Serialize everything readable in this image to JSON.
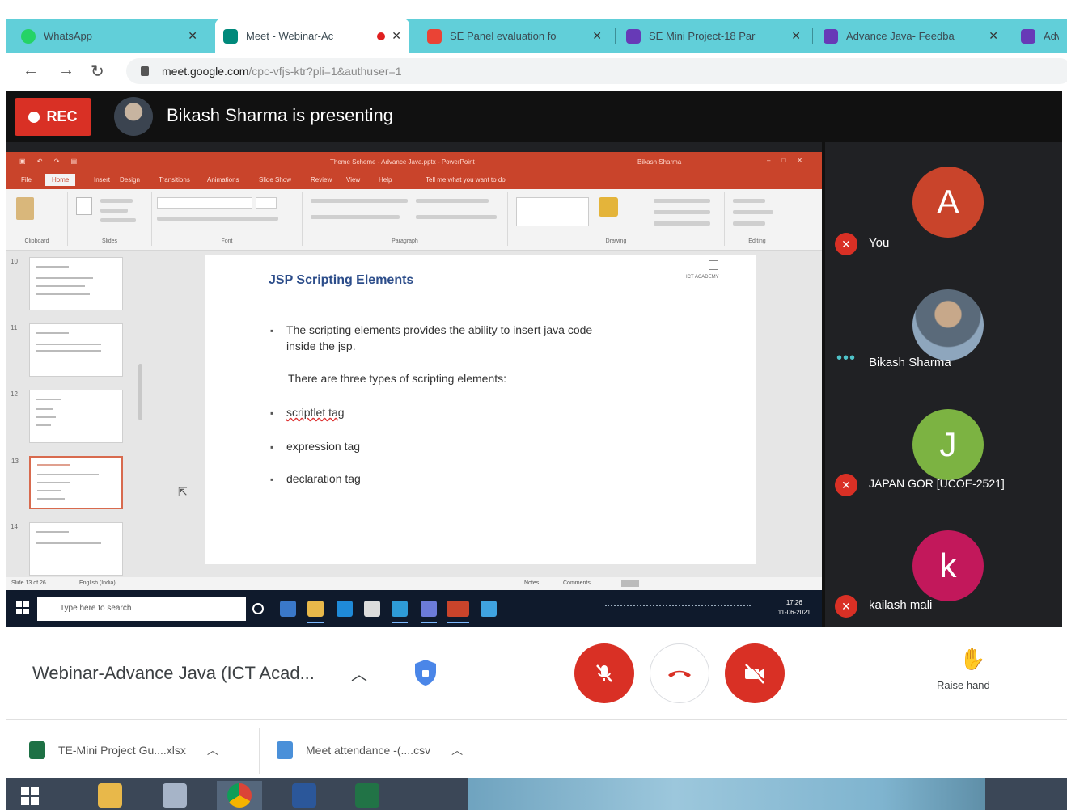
{
  "browser": {
    "tabs": [
      {
        "label": "WhatsApp",
        "icon": "whatsapp-icon",
        "color": "#25d366"
      },
      {
        "label": "Meet - Webinar-Ac",
        "icon": "google-meet-icon",
        "color": "#00897b",
        "active": true,
        "recording": true
      },
      {
        "label": "SE Panel evaluation fo",
        "icon": "gmail-icon",
        "color": "#ea4335"
      },
      {
        "label": "SE Mini Project-18 Par",
        "icon": "forms-icon",
        "color": "#673ab7"
      },
      {
        "label": "Advance Java- Feedba",
        "icon": "forms-icon",
        "color": "#673ab7"
      },
      {
        "label": "Adv",
        "icon": "forms-icon",
        "color": "#673ab7"
      }
    ],
    "address": {
      "host": "meet.google.com",
      "path": "/cpc-vfjs-ktr?pli=1&authuser=1"
    }
  },
  "meet": {
    "rec_label": "REC",
    "presenting_text": "Bikash Sharma is presenting",
    "meeting_name": "Webinar-Advance Java (ICT Acad...",
    "raise_hand_label": "Raise hand",
    "participants": [
      {
        "name": "You",
        "initial": "A",
        "color": "#c9442b",
        "muted": true
      },
      {
        "name": "Bikash Sharma",
        "initial": "",
        "color": "#5a6a7a",
        "muted": false
      },
      {
        "name": "JAPAN GOR [UCOE-2521]",
        "initial": "J",
        "color": "#7cb342",
        "muted": true
      },
      {
        "name": "kailash mali",
        "initial": "k",
        "color": "#c2185b",
        "muted": true
      }
    ]
  },
  "powerpoint": {
    "window_title": "Theme Scheme - Advance Java.pptx - PowerPoint",
    "user_label": "Bikash Sharma",
    "ribbon_tabs": [
      "File",
      "Home",
      "Insert",
      "Design",
      "Transitions",
      "Animations",
      "Slide Show",
      "Review",
      "View",
      "Help",
      "Tell me what you want to do"
    ],
    "ribbon_groups": [
      "Clipboard",
      "Slides",
      "Font",
      "Paragraph",
      "Drawing",
      "Editing"
    ],
    "slide": {
      "title": "JSP Scripting Elements",
      "logo_text": "ICT ACADEMY",
      "intro_line1": "The scripting elements provides the ability to insert java code",
      "intro_line2": "inside the jsp.",
      "types_line": "There are three types of scripting elements:",
      "items": [
        "scriptlet tag",
        "expression tag",
        "declaration tag"
      ]
    },
    "thumb_numbers": [
      "10",
      "11",
      "12",
      "13",
      "14"
    ],
    "status_left": "Slide 13 of 26",
    "status_lang": "English (India)",
    "status_notes": "Notes",
    "status_comments": "Comments",
    "taskbar_search": "Type here to search",
    "clock_time": "17:26",
    "clock_date": "11-06-2021"
  },
  "downloads": [
    {
      "name": "TE-Mini Project Gu....xlsx",
      "icon": "excel-file-icon",
      "color": "#1e7145"
    },
    {
      "name": "Meet attendance -(....csv",
      "icon": "csv-file-icon",
      "color": "#4a90d9"
    }
  ],
  "colors": {
    "accent_red": "#d93025",
    "tab_strip": "#61cfd9",
    "meet_bg": "#202124"
  }
}
